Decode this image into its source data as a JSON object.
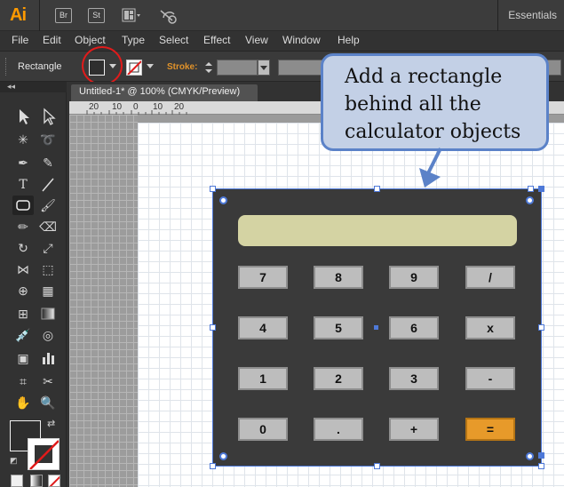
{
  "app": {
    "logo": "Ai",
    "bridge_label": "Br",
    "stock_label": "St",
    "workspace": "Essentials"
  },
  "menu": [
    "File",
    "Edit",
    "Object",
    "Type",
    "Select",
    "Effect",
    "View",
    "Window",
    "Help"
  ],
  "control_panel": {
    "tool_name": "Rectangle",
    "stroke_label": "Stroke:"
  },
  "document": {
    "tab_title": "Untitled-1* @ 100% (CMYK/Preview)",
    "ruler_marks": [
      "20",
      "10",
      "0",
      "10",
      "20"
    ]
  },
  "calculator": {
    "display": "",
    "keys": [
      [
        "7",
        "8",
        "9",
        "/"
      ],
      [
        "4",
        "5",
        "6",
        "x"
      ],
      [
        "1",
        "2",
        "3",
        "-"
      ],
      [
        "0",
        ".",
        "+",
        "="
      ]
    ]
  },
  "callout": {
    "text": "Add a rectangle behind all the calculator objects"
  },
  "colors": {
    "accent_orange": "#ff9a00",
    "annotation_red": "#e01b1b",
    "selection_blue": "#4e79d8",
    "callout_fill": "#c3d0e6",
    "display_fill": "#d4d3a3",
    "equals_key": "#e79a2a"
  }
}
